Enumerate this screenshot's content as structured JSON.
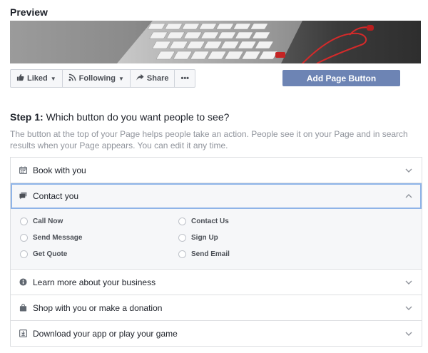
{
  "preview": {
    "title": "Preview"
  },
  "actions": [
    {
      "label": "Liked",
      "icon": "thumbs-up-icon"
    },
    {
      "label": "Following",
      "icon": "rss-icon"
    },
    {
      "label": "Share",
      "icon": "share-arrow-icon"
    },
    {
      "label": "•••",
      "icon": "more-icon"
    }
  ],
  "add_button": {
    "label": "Add Page Button",
    "color": "#6d84b4"
  },
  "step": {
    "prefix": "Step 1:",
    "question": " Which button do you want people to see?"
  },
  "description": "The button at the top of your Page helps people take an action. People see it on your Page and in search results when your Page appears. You can edit it any time.",
  "rows": [
    {
      "label": "Book with you",
      "icon": "calendar-icon"
    },
    {
      "label": "Contact you",
      "icon": "chat-icon",
      "expanded": true
    },
    {
      "label": "Learn more about your business",
      "icon": "info-icon"
    },
    {
      "label": "Shop with you or make a donation",
      "icon": "shopping-bag-icon"
    },
    {
      "label": "Download your app or play your game",
      "icon": "download-icon"
    }
  ],
  "contact_options": [
    {
      "label": "Call Now"
    },
    {
      "label": "Contact Us"
    },
    {
      "label": "Send Message"
    },
    {
      "label": "Sign Up"
    },
    {
      "label": "Get Quote"
    },
    {
      "label": "Send Email"
    }
  ],
  "colors": {
    "accent": "#6d84b4",
    "active_outline": "#8fb4e8",
    "muted_text": "#90949c"
  }
}
